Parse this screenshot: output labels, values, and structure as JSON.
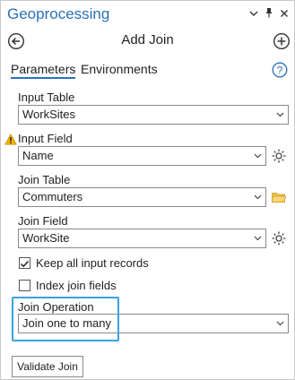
{
  "window": {
    "title": "Geoprocessing",
    "controls": [
      "chevron-down-icon",
      "pin-icon",
      "close-icon"
    ]
  },
  "tool": {
    "heading": "Add Join",
    "back_icon": "circle-arrow-left-icon",
    "add_icon": "circle-plus-icon"
  },
  "tabs": {
    "parameters": "Parameters",
    "environments": "Environments",
    "active": "Parameters",
    "help_icon": "question-circle-icon"
  },
  "params": {
    "input_table": {
      "label": "Input Table",
      "value": "WorkSites"
    },
    "input_field": {
      "label": "Input Field",
      "value": "Name",
      "warning": true
    },
    "join_table": {
      "label": "Join Table",
      "value": "Commuters"
    },
    "join_field": {
      "label": "Join Field",
      "value": "WorkSite"
    },
    "keep_all": {
      "label": "Keep all input records",
      "checked": true
    },
    "index_join": {
      "label": "Index join fields",
      "checked": false
    },
    "join_operation": {
      "label": "Join Operation",
      "value": "Join one to many"
    }
  },
  "actions": {
    "validate_label": "Validate Join"
  },
  "colors": {
    "accent": "#2a71b8",
    "highlight_border": "#3da0e0",
    "warning": "#f0b400"
  }
}
